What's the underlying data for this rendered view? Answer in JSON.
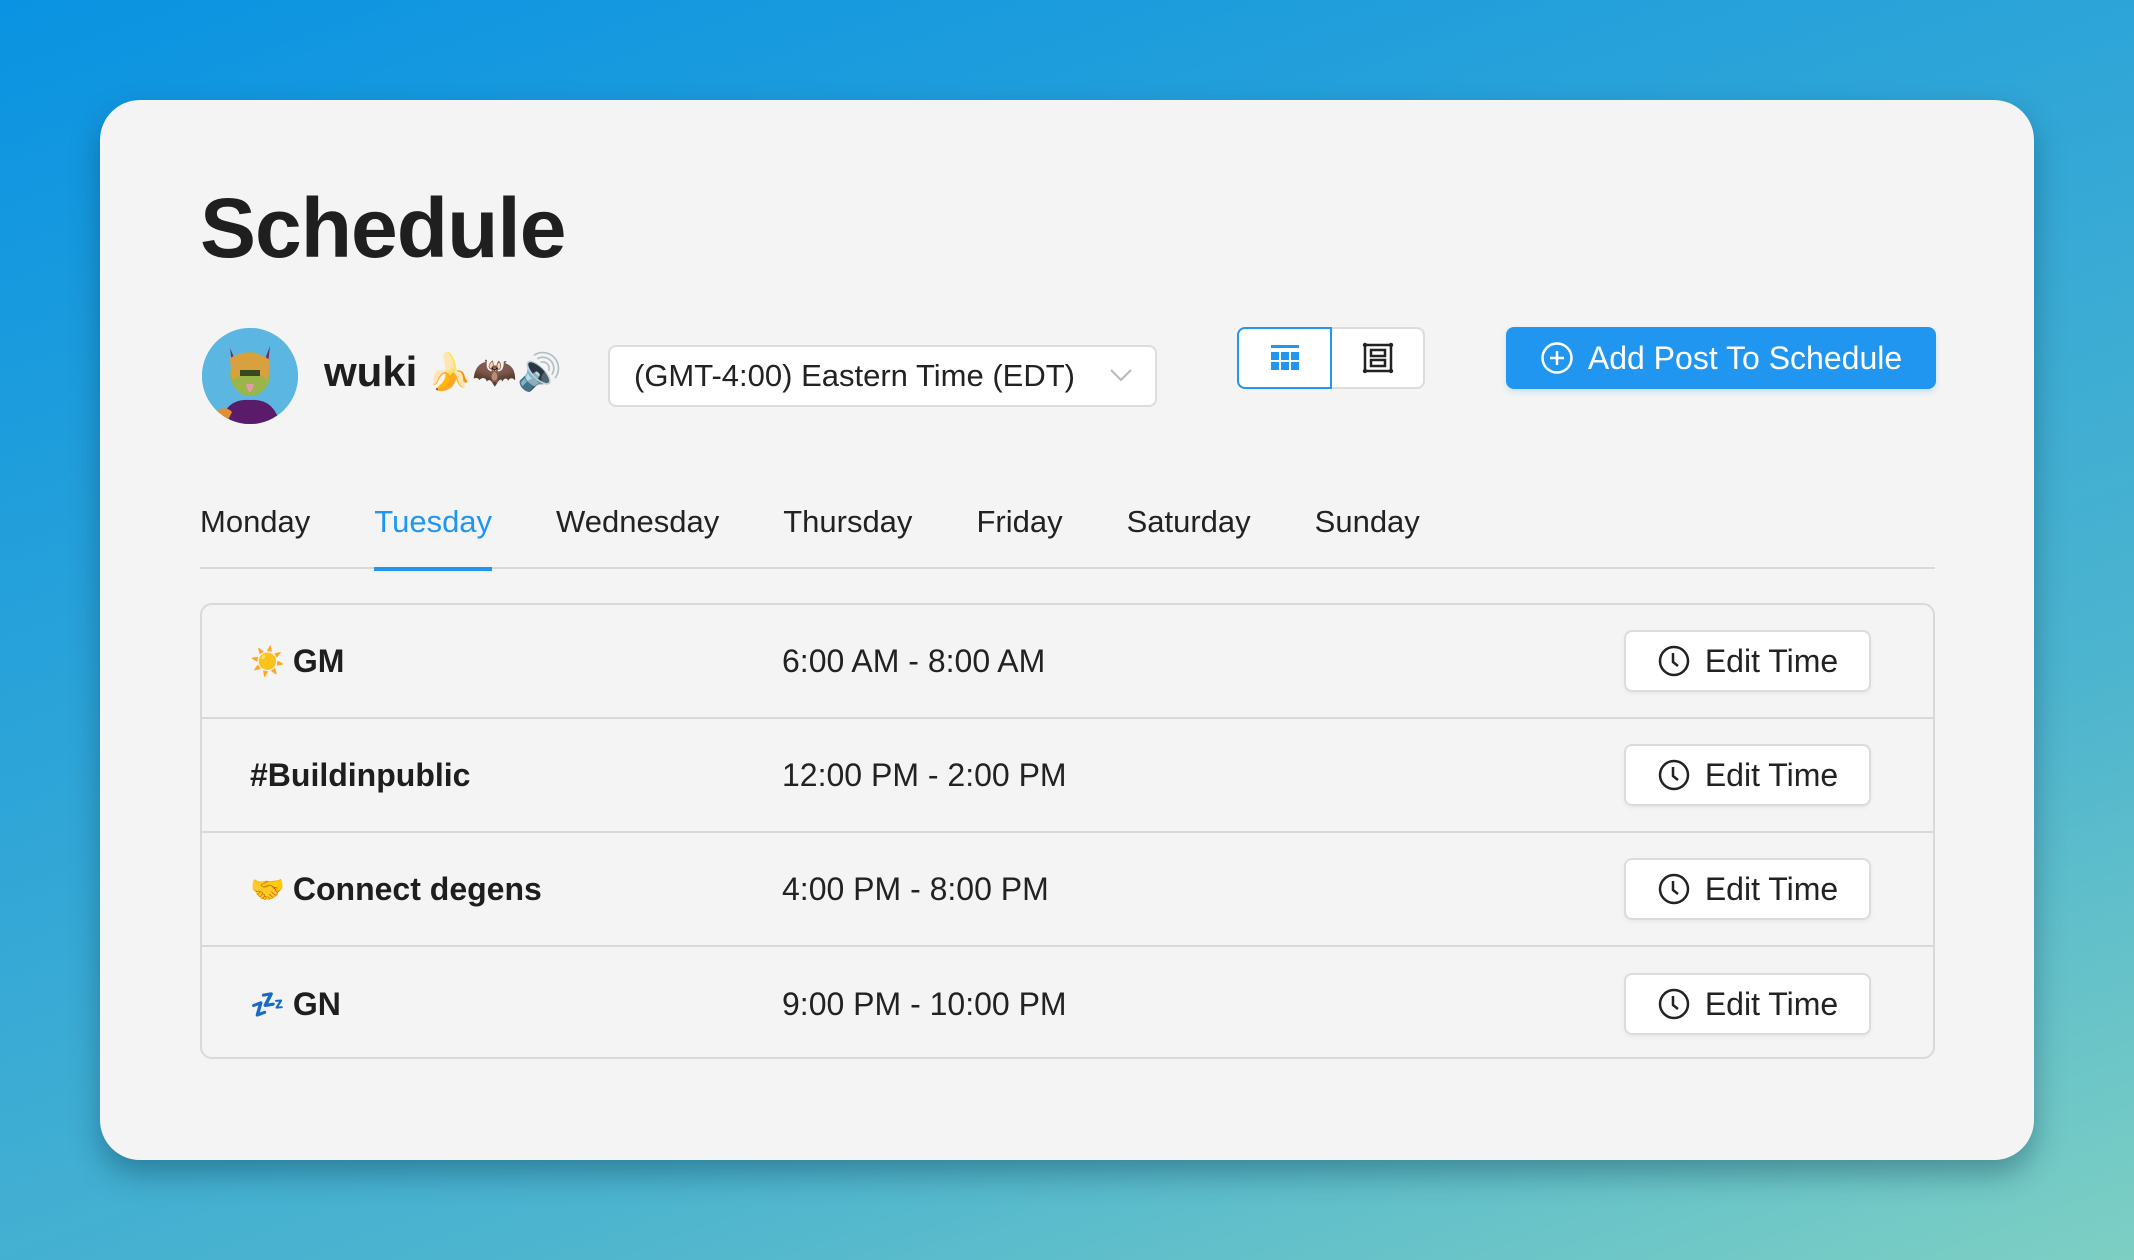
{
  "page": {
    "title": "Schedule"
  },
  "profile": {
    "username": "wuki",
    "username_emoji": "🍌🦇🔊",
    "avatar_icon": "ape-avatar"
  },
  "timezone": {
    "selected": "(GMT-4:00) Eastern Time (EDT)",
    "icon": "chevron-down-icon"
  },
  "view_toggle": {
    "options": [
      {
        "name": "calendar-view",
        "icon": "calendar-grid-icon",
        "active": true
      },
      {
        "name": "list-view",
        "icon": "list-frame-icon",
        "active": false
      }
    ]
  },
  "actions": {
    "add_post_label": "Add Post To Schedule",
    "add_post_icon": "plus-circle-icon"
  },
  "colors": {
    "accent": "#2196f0",
    "card_bg": "#f4f4f4",
    "border": "#d9d9d9"
  },
  "tabs": [
    {
      "label": "Monday",
      "active": false
    },
    {
      "label": "Tuesday",
      "active": true
    },
    {
      "label": "Wednesday",
      "active": false
    },
    {
      "label": "Thursday",
      "active": false
    },
    {
      "label": "Friday",
      "active": false
    },
    {
      "label": "Saturday",
      "active": false
    },
    {
      "label": "Sunday",
      "active": false
    }
  ],
  "slots": [
    {
      "emoji": "☀️",
      "name": "GM",
      "time": "6:00 AM - 8:00 AM",
      "button": "Edit Time"
    },
    {
      "emoji": "",
      "name": "#Buildinpublic",
      "time": "12:00 PM - 2:00 PM",
      "button": "Edit Time"
    },
    {
      "emoji": "🤝",
      "name": "Connect degens",
      "time": "4:00 PM - 8:00 PM",
      "button": "Edit Time"
    },
    {
      "emoji": "💤",
      "name": "GN",
      "time": "9:00 PM - 10:00 PM",
      "button": "Edit Time"
    }
  ]
}
